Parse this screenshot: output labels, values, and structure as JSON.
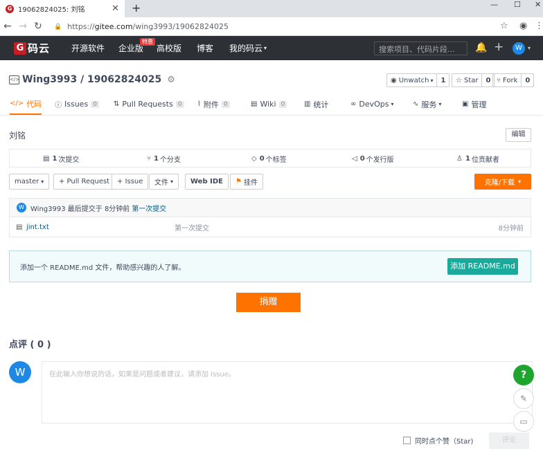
{
  "browser": {
    "tab_title": "19062824025: 刘铭",
    "favicon_letter": "G",
    "url_scheme": "https://",
    "url_host": "gitee.com",
    "url_path": "/wing3993/19062824025"
  },
  "header": {
    "logo_letter": "G",
    "logo_text": "码云",
    "nav": [
      "开源软件",
      "企业版",
      "高校版",
      "博客",
      "我的码云"
    ],
    "special_badge": "特惠",
    "search_placeholder": "搜索项目、代码片段...",
    "avatar_letter": "W"
  },
  "repo": {
    "title": "Wing3993 / 19062824025",
    "icon_text": "</>",
    "watch_label": "Unwatch",
    "watch_count": "1",
    "star_label": "Star",
    "star_count": "0",
    "fork_label": "Fork",
    "fork_count": "0"
  },
  "tabs": [
    {
      "label": "代码"
    },
    {
      "label": "Issues",
      "count": "0"
    },
    {
      "label": "Pull Requests",
      "count": "0"
    },
    {
      "label": "附件",
      "count": "0"
    },
    {
      "label": "Wiki",
      "count": "0"
    },
    {
      "label": "统计"
    },
    {
      "label": "DevOps"
    },
    {
      "label": "服务"
    },
    {
      "label": "管理"
    }
  ],
  "description": "刘铭",
  "edit_label": "编辑",
  "stats": {
    "commits_n": "1",
    "commits_label": "次提交",
    "branches_n": "1",
    "branches_label": "个分支",
    "tags_n": "0",
    "tags_label": "个标签",
    "releases_n": "0",
    "releases_label": "个发行版",
    "contributors_n": "1",
    "contributors_label": "位贡献者"
  },
  "actions": {
    "branch": "master",
    "pull_request": "+ Pull Request",
    "issue": "+ Issue",
    "file": "文件",
    "webide": "Web IDE",
    "widget": "挂件",
    "clone": "克隆/下载"
  },
  "commit": {
    "avatar_letter": "W",
    "author_line": "Wing3993 最后提交于 8分钟前",
    "message": "第一次提交"
  },
  "files": [
    {
      "name": "jint.txt",
      "message": "第一次提交",
      "time": "8分钟前"
    }
  ],
  "readme_notice": {
    "text": "添加一个 README.md 文件，帮助感兴趣的人了解。",
    "button": "添加 README.md"
  },
  "donate_label": "捐赠",
  "comments": {
    "title": "点评 ( 0 )",
    "avatar_letter": "W",
    "placeholder": "在此输入你想说的话，如果是问题或者建议，请添加 issue。",
    "star_label": "同时点个赞（Star)",
    "submit": "评论"
  },
  "colors": {
    "accent_orange": "#fe7300",
    "brand_red": "#c71d23",
    "teal": "#1aaa9c",
    "help_green": "#1fa52e"
  }
}
